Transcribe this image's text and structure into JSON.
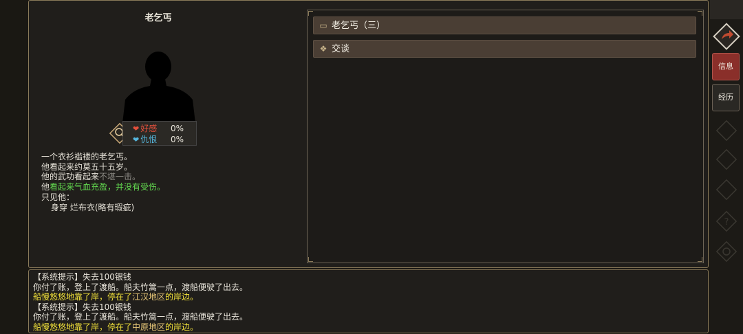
{
  "npc": {
    "name": "老乞丐",
    "relations": {
      "favor_label": "好感",
      "favor_value": "0%",
      "hatred_label": "仇恨",
      "hatred_value": "0%"
    },
    "description": {
      "line1": "一个衣衫褴褛的老乞丐。",
      "line2": "他看起来约莫五十五岁。",
      "line3_prefix": "他的武功看起来",
      "line3_highlight": "不堪一击。",
      "line4_prefix": "他",
      "line4_highlight": "看起来气血充盈，并没有受伤。",
      "line5": "只见他：",
      "line6": "身穿 烂布衣(略有瑕疵)"
    }
  },
  "actions": [
    {
      "label": "老乞丐（三）",
      "icon": "talk-scroll-icon"
    },
    {
      "label": "交谈",
      "icon": "diamond-cluster-icon"
    }
  ],
  "log": {
    "line1": "【系统提示】失去100银钱",
    "line2": "你付了账，登上了渡船。船夫竹篙一点，渡船便驶了出去。",
    "line3_a": "船慢悠悠地靠了岸，停在了",
    "line3_b": "江汉地区",
    "line3_c": "的岸边。",
    "line4": "【系统提示】失去100银钱",
    "line5": "你付了账，登上了渡船。船夫竹篙一点，渡船便驶了出去。",
    "line6_a": "船慢悠悠地靠了岸，停在了",
    "line6_b": "中原地区",
    "line6_c": "的岸边。"
  },
  "sidebar": {
    "info_label": "信息",
    "exp_label": "经历"
  },
  "colors": {
    "panel_border": "#8a7a5a",
    "highlight_green": "#62d84f",
    "highlight_yellow": "#f2e23a",
    "favor_heart": "#e6503c",
    "hatred_heart": "#56b8e0",
    "active_tab": "#8a2f2a"
  }
}
